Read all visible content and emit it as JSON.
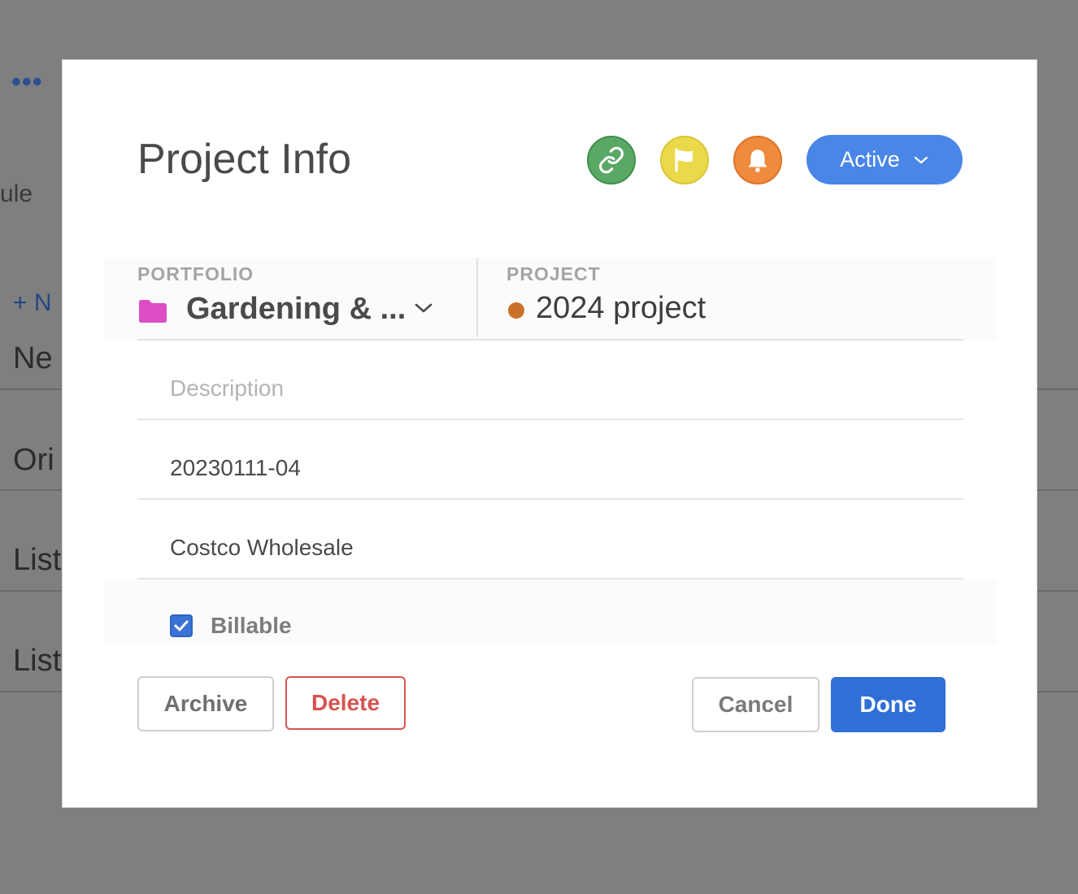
{
  "background": {
    "more_label": "•••",
    "partial_schedule": "ule",
    "new_button": "+ N",
    "rows": [
      "Ne",
      "Ori",
      "List",
      "List"
    ]
  },
  "modal": {
    "title": "Project Info",
    "status": {
      "label": "Active",
      "color": "#4a86e8"
    },
    "header_icons": [
      {
        "name": "link-icon",
        "color": "#5aa865"
      },
      {
        "name": "flag-icon",
        "color": "#ecd94a"
      },
      {
        "name": "bell-icon",
        "color": "#f08a3c"
      }
    ],
    "portfolio": {
      "label": "PORTFOLIO",
      "value": "Gardening & ...",
      "folder_color": "#dd4dc3"
    },
    "project": {
      "label": "PROJECT",
      "value": "2024 project",
      "dot_color": "#c9702a"
    },
    "description": {
      "value": "",
      "placeholder": "Description"
    },
    "project_number": {
      "value": "20230111-04"
    },
    "client": {
      "value": "Costco Wholesale"
    },
    "billable": {
      "label": "Billable",
      "checked": true
    },
    "buttons": {
      "archive": "Archive",
      "delete": "Delete",
      "cancel": "Cancel",
      "done": "Done"
    }
  }
}
